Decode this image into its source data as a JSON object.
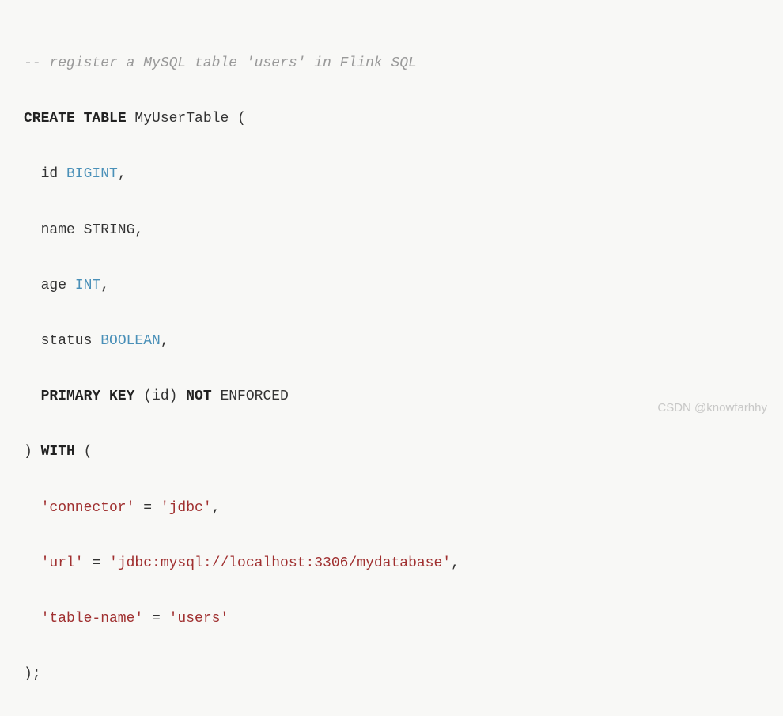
{
  "code": {
    "comment": "-- register a MySQL table 'users' in Flink SQL",
    "kw_create_table": "CREATE TABLE",
    "table_name": " MyUserTable (",
    "col_id_name": "id ",
    "col_id_type": "BIGINT",
    "comma": ",",
    "col_name_text": "name STRING,",
    "col_age_name": "age ",
    "col_age_type": "INT",
    "col_status_name": "status ",
    "col_status_type": "BOOLEAN",
    "kw_primary_key": "PRIMARY KEY",
    "pk_mid": " (id) ",
    "kw_not": "NOT",
    "pk_end": " ENFORCED",
    "close_paren": ") ",
    "kw_with": "WITH",
    "with_open": " (",
    "opt1_key": "'connector'",
    "eq": " = ",
    "opt1_val": "'jdbc'",
    "opt2_key": "'url'",
    "opt2_val": "'jdbc:mysql://localhost:3306/mydatabase'",
    "opt3_key": "'table-name'",
    "opt3_val": "'users'",
    "end": ");"
  },
  "watermark": "CSDN @knowfarhhy"
}
